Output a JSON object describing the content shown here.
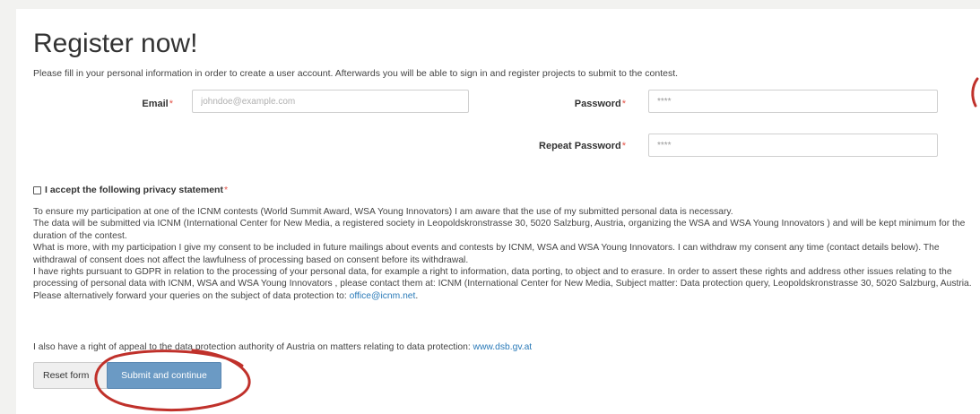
{
  "form": {
    "title": "Register now!",
    "intro": "Please fill in your personal information in order to create a user account. Afterwards you will be able to sign in and register projects to submit to the contest.",
    "required_marker": "*",
    "email": {
      "label": "Email",
      "placeholder": "johndoe@example.com"
    },
    "password": {
      "label": "Password",
      "value": "****"
    },
    "repeat_password": {
      "label": "Repeat Password",
      "value": "****"
    }
  },
  "privacy": {
    "checkbox_label": "I accept the following privacy statement",
    "paragraphs": [
      "To ensure my participation at one of the ICNM contests (World Summit Award, WSA Young Innovators) I am aware that the use of my submitted personal data is necessary.",
      "The data will be submitted via ICNM (International Center for New Media, a registered society in Leopoldskronstrasse 30, 5020 Salzburg, Austria, organizing the WSA and WSA Young Innovators ) and will be kept minimum for the duration of the contest.",
      "What is more, with my participation I give my consent to be included in future mailings about events and contests by ICNM, WSA and WSA Young Innovators. I can withdraw my consent any time (contact details below). The withdrawal of consent does not affect the lawfulness of processing based on consent before its withdrawal.",
      "I have rights pursuant to GDPR in relation to the processing of your personal data, for example a right to information, data porting, to object and to erasure. In order to assert these rights and address other issues relating to the processing of personal data with ICNM, WSA and WSA Young Innovators , please contact them at: ICNM (International Center for New Media, Subject matter: Data protection query, Leopoldskronstrasse 30, 5020 Salzburg, Austria. Please alternatively forward your queries on the subject of data protection to: "
    ],
    "office_email": "office@icnm.net",
    "appeal_text": "I also have a right of appeal to the data protection authority of Austria on matters relating to data protection: ",
    "appeal_link": "www.dsb.gv.at",
    "link_color": "#2a7ab8"
  },
  "buttons": {
    "reset": "Reset form",
    "submit": "Submit and continue"
  },
  "annotation": {
    "color": "#c0312b"
  }
}
